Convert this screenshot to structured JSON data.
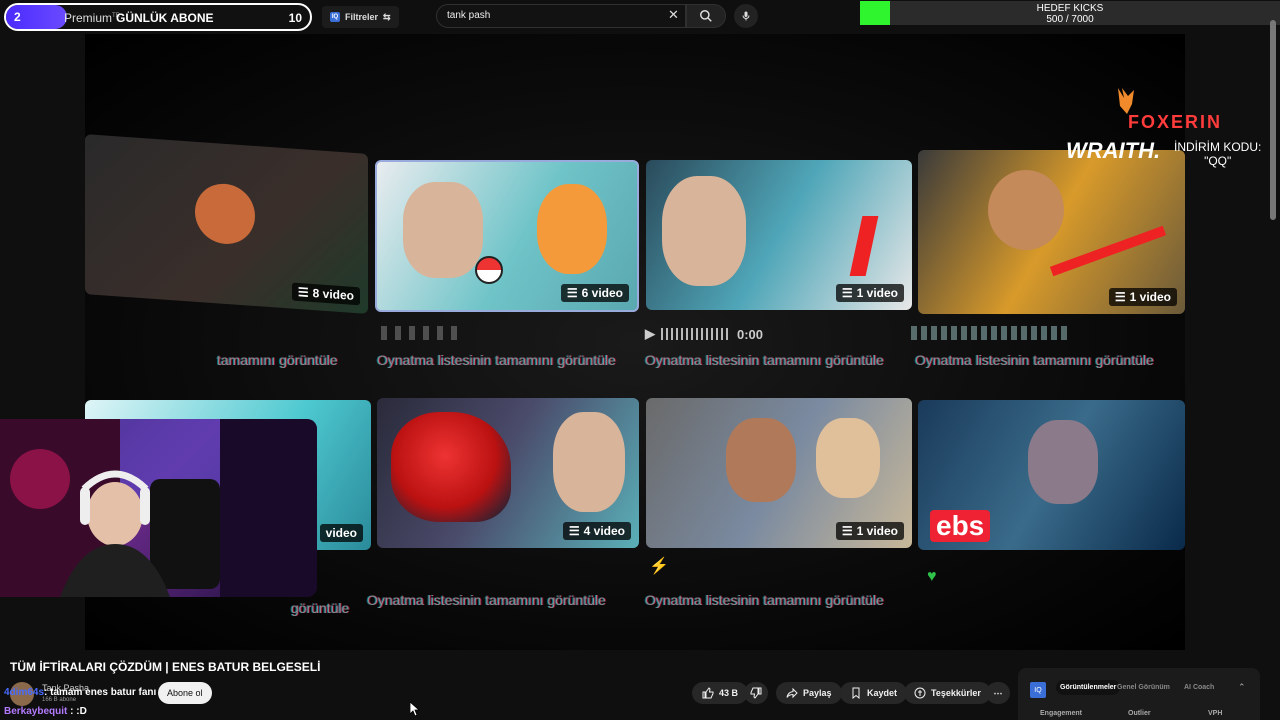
{
  "subscriber_widget": {
    "count": "2",
    "brand": "Premium",
    "brand_tm": "TR",
    "title": "GÜNLÜK ABONE",
    "goal": "10",
    "progress_fraction": 0.2
  },
  "toolbar": {
    "filter_label": "Filtreler",
    "search_value": "tank pash"
  },
  "kicks_goal": {
    "title": "HEDEF KICKS",
    "value": "500 / 7000",
    "progress_fraction": 0.0714
  },
  "video_thumbnails": {
    "row1": [
      {
        "badge": "8 video",
        "caption": "tamamını görüntüle",
        "tone": "#3a2e2a"
      },
      {
        "badge": "6 video",
        "caption": "Oynatma listesinin tamamını görüntüle",
        "tone": "#6fc4c8"
      },
      {
        "badge": "1 video",
        "caption": "Oynatma listesinin tamamını görüntüle",
        "tone": "#4fa6b8"
      },
      {
        "badge": "1 video",
        "caption": "Oynatma listesinin tamamını görüntüle",
        "tone": "#d89a2a"
      }
    ],
    "row2": [
      {
        "badge": "video",
        "caption": "görüntüle",
        "tone": "#4ec9d0"
      },
      {
        "badge": "4 video",
        "caption": "Oynatma listesinin tamamını görüntüle",
        "tone": "#4a4a6a"
      },
      {
        "badge": "1 video",
        "caption": "Oynatma listesinin tamamını görüntüle",
        "tone": "#7a8aa0"
      },
      {
        "badge": "ebs",
        "caption": "",
        "tone": "#3a6b8a"
      }
    ],
    "audio_timestamp": "0:00"
  },
  "sponsor": {
    "brand": "FOXERIN",
    "product": "WRAITH.",
    "code_label": "İNDİRİM KODU:",
    "code": "\"QQ\""
  },
  "video": {
    "title": "TÜM İFTİRALARI ÇÖZDÜM | ENES BATUR BELGESELİ",
    "channel_name": "Tank Pasha",
    "channel_subs": "166 B abone",
    "subscribe_label": "Abone ol"
  },
  "chat": [
    {
      "user": "4dim64s",
      "message": ": tamam enes batur fanı",
      "color": "#4a6cff"
    },
    {
      "user": "Berkaybequit",
      "message": " : :D",
      "color": "#b37aff"
    }
  ],
  "actions": {
    "likes": "43 B",
    "share": "Paylaş",
    "save": "Kaydet",
    "thanks": "Teşekkürler"
  },
  "iq_panel": {
    "tabs": [
      "Görüntülenmeler",
      "Genel Görünüm",
      "AI Coach"
    ],
    "columns": [
      "Engagement",
      "Outlier",
      "VPH"
    ]
  },
  "colors": {
    "accent_purple": "#5b3bff",
    "kicks_green": "#2ef52e"
  }
}
